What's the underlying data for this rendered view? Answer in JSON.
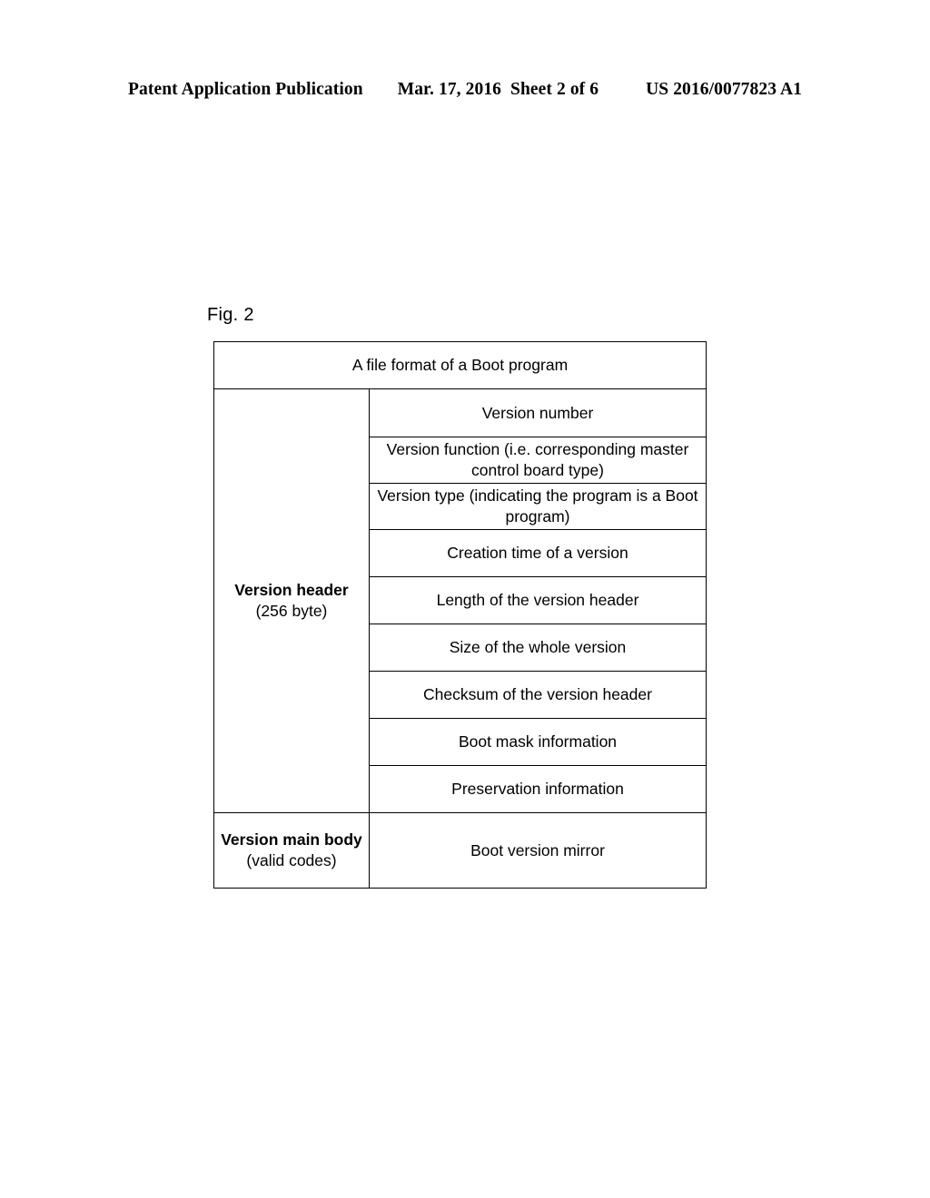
{
  "page_header": {
    "publication": "Patent Application Publication",
    "date": "Mar. 17, 2016",
    "sheet": "Sheet 2 of 6",
    "patent_number": "US 2016/0077823 A1"
  },
  "figure": {
    "label": "Fig. 2",
    "title": "A file format of a Boot program",
    "sections": [
      {
        "label_main": "Version header",
        "label_sub": "(256 byte)",
        "rows": [
          "Version number",
          "Version function (i.e. corresponding master control board type)",
          "Version type (indicating the program is a Boot program)",
          "Creation time of a version",
          "Length of the version header",
          "Size of the whole version",
          "Checksum of the version header",
          "Boot mask information",
          "Preservation information"
        ]
      },
      {
        "label_main": "Version main body",
        "label_sub": "(valid codes)",
        "rows": [
          "Boot version mirror"
        ]
      }
    ]
  }
}
